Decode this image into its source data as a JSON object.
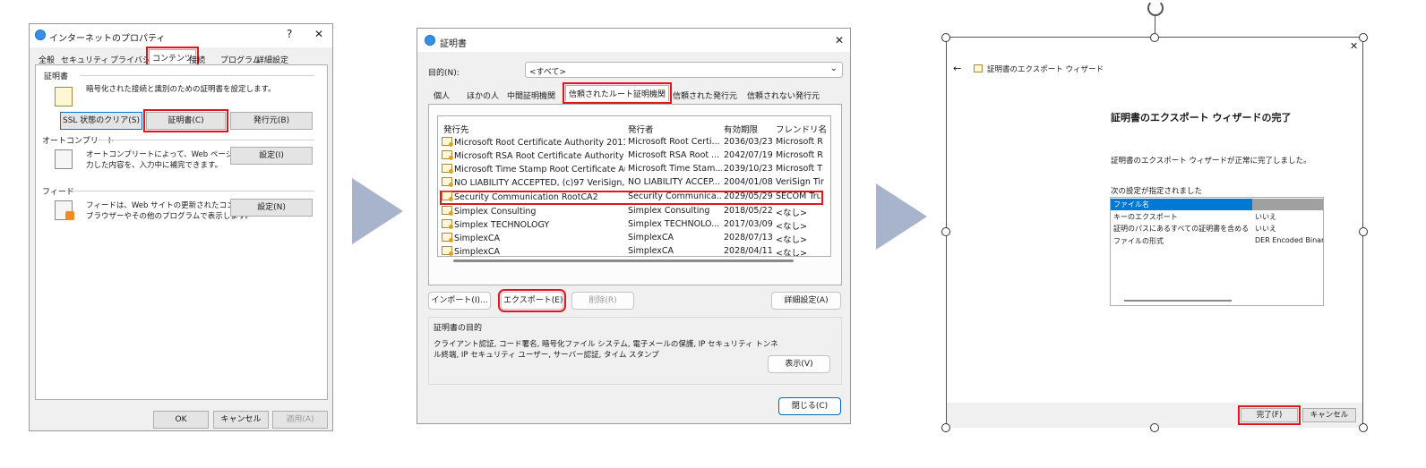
{
  "dialog1": {
    "title": "インターネットのプロパティ",
    "help": "?",
    "close": "✕",
    "tabs": [
      "全般",
      "セキュリティ",
      "プライバシー",
      "コンテンツ",
      "接続",
      "プログラム",
      "詳細設定"
    ],
    "cert_group": "証明書",
    "cert_desc": "暗号化された接続と識別のための証明書を設定します。",
    "ssl_button": "SSL 状態のクリア(S)",
    "certs_button": "証明書(C)",
    "publishers_button": "発行元(B)",
    "autocomplete_group": "オートコンプリート",
    "autocomplete_desc1": "オートコンプリートによって、Web ページで前回入",
    "autocomplete_desc2": "力した内容を、入力中に補完できます。",
    "autocomplete_settings": "設定(I)",
    "feed_group": "フィード",
    "feed_desc1": "フィードは、Web サイトの更新されたコンテンツを",
    "feed_desc2": "ブラウザーやその他のプログラムで表示します。",
    "feed_settings": "設定(N)",
    "ok": "OK",
    "cancel": "キャンセル",
    "apply": "適用(A)"
  },
  "dialog2": {
    "title": "証明書",
    "close": "✕",
    "purpose_label": "目的(N):",
    "purpose_value": "<すべて>",
    "tabs": [
      "個人",
      "ほかの人",
      "中間証明機関",
      "信頼されたルート証明機関",
      "信頼された発行元",
      "信頼されない発行元"
    ],
    "columns": [
      "発行先",
      "発行者",
      "有効期限",
      "フレンドリ名"
    ],
    "rows": [
      {
        "to": "Microsoft Root Certificate Authority 2011",
        "by": "Microsoft Root Certi...",
        "exp": "2036/03/23",
        "name": "Microsoft R"
      },
      {
        "to": "Microsoft RSA Root Certificate Authority ...",
        "by": "Microsoft RSA Root ...",
        "exp": "2042/07/19",
        "name": "Microsoft R"
      },
      {
        "to": "Microsoft Time Stamp Root Certificate Au...",
        "by": "Microsoft Time Stam...",
        "exp": "2039/10/23",
        "name": "Microsoft T"
      },
      {
        "to": "NO LIABILITY ACCEPTED, (c)97 VeriSign, I...",
        "by": "NO LIABILITY ACCEP...",
        "exp": "2004/01/08",
        "name": "VeriSign Tir"
      },
      {
        "to": "Security Communication RootCA2",
        "by": "Security Communica...",
        "exp": "2029/05/29",
        "name": "SECOM Tru"
      },
      {
        "to": "Simplex Consulting",
        "by": "Simplex Consulting",
        "exp": "2018/05/22",
        "name": "<なし>"
      },
      {
        "to": "Simplex TECHNOLOGY",
        "by": "Simplex TECHNOLO...",
        "exp": "2017/03/09",
        "name": "<なし>"
      },
      {
        "to": "SimplexCA",
        "by": "SimplexCA",
        "exp": "2028/07/13",
        "name": "<なし>"
      },
      {
        "to": "SimplexCA",
        "by": "SimplexCA",
        "exp": "2028/04/11",
        "name": "<なし>"
      }
    ],
    "import": "インポート(I)...",
    "export": "エクスポート(E)...",
    "remove": "削除(R)",
    "advanced": "詳細設定(A)",
    "purpose_group": "証明書の目的",
    "purpose_text1": "クライアント認証, コード署名, 暗号化ファイル システム, 電子メールの保護, IP セキュリティ トンネ",
    "purpose_text2": "ル終端, IP セキュリティ ユーザー, サーバー認証, タイム スタンプ",
    "view": "表示(V)",
    "close_btn": "閉じる(C)"
  },
  "dialog3": {
    "back": "←",
    "title": "証明書のエクスポート ウィザード",
    "close": "✕",
    "heading": "証明書のエクスポート ウィザードの完了",
    "message": "証明書のエクスポート ウィザードが正常に完了しました。",
    "settings_label": "次の設定が指定されました",
    "settings": [
      {
        "key": "ファイル名",
        "value": ""
      },
      {
        "key": "キーのエクスポート",
        "value": "いいえ"
      },
      {
        "key": "証明のパスにあるすべての証明書を含める",
        "value": "いいえ"
      },
      {
        "key": "ファイルの形式",
        "value": "DER Encoded Binar"
      }
    ],
    "finish": "完了(F)",
    "cancel": "キャンセル"
  },
  "colors": {
    "highlight": "#e3161c",
    "selection": "#0078d4",
    "arrow": "#a8b4cc"
  },
  "icons": [
    "internet-options-icon",
    "certificate-icon",
    "rotate-handle-icon",
    "arrow-right-icon"
  ]
}
